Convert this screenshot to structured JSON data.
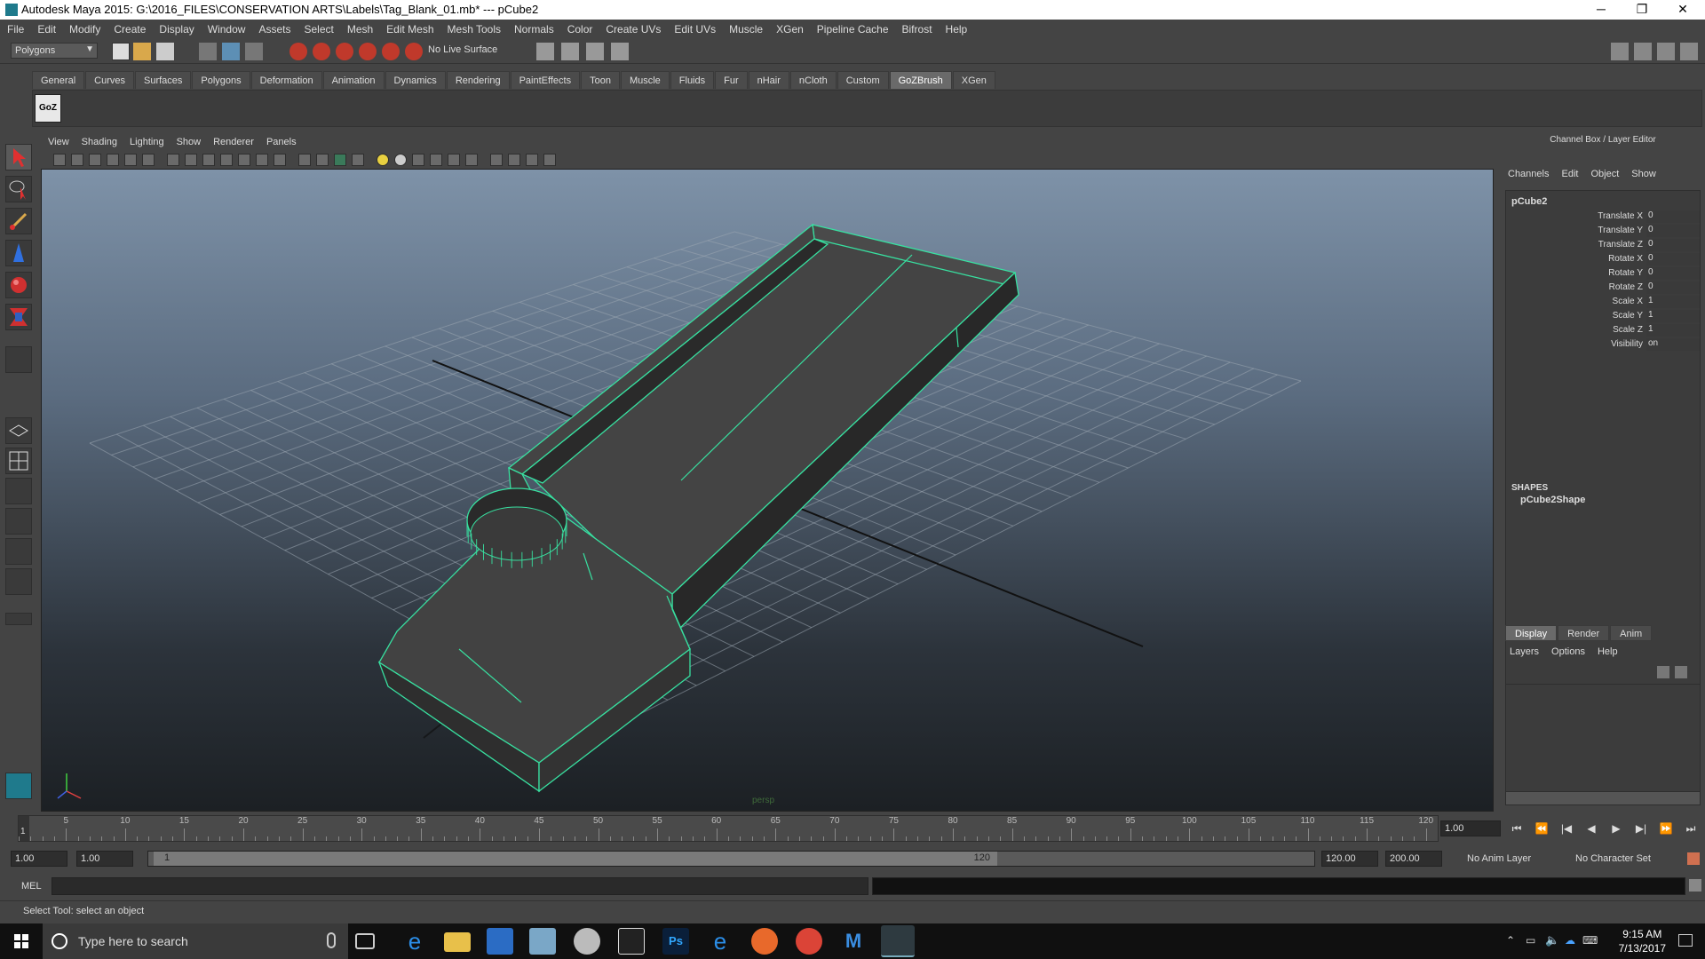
{
  "window": {
    "title": "Autodesk Maya 2015: G:\\2016_FILES\\CONSERVATION ARTS\\Labels\\Tag_Blank_01.mb*   ---   pCube2",
    "minimize": "─",
    "maximize": "❐",
    "close": "✕"
  },
  "menubar": [
    "File",
    "Edit",
    "Modify",
    "Create",
    "Display",
    "Window",
    "Assets",
    "Select",
    "Mesh",
    "Edit Mesh",
    "Mesh Tools",
    "Normals",
    "Color",
    "Create UVs",
    "Edit UVs",
    "Muscle",
    "XGen",
    "Pipeline Cache",
    "Bifrost",
    "Help"
  ],
  "statusline": {
    "menu_set": "Polygons",
    "live_surface": "No Live Surface"
  },
  "shelf": {
    "tabs": [
      "General",
      "Curves",
      "Surfaces",
      "Polygons",
      "Deformation",
      "Animation",
      "Dynamics",
      "Rendering",
      "PaintEffects",
      "Toon",
      "Muscle",
      "Fluids",
      "Fur",
      "nHair",
      "nCloth",
      "Custom",
      "GoZBrush",
      "XGen"
    ],
    "active_tab": "GoZBrush",
    "goz_label": "GoZ"
  },
  "viewport": {
    "menus": [
      "View",
      "Shading",
      "Lighting",
      "Show",
      "Renderer",
      "Panels"
    ],
    "camera_label": "persp"
  },
  "channel_box": {
    "header": "Channel Box / Layer Editor",
    "menus": [
      "Channels",
      "Edit",
      "Object",
      "Show"
    ],
    "object_name": "pCube2",
    "attributes": [
      {
        "label": "Translate X",
        "value": "0"
      },
      {
        "label": "Translate Y",
        "value": "0"
      },
      {
        "label": "Translate Z",
        "value": "0"
      },
      {
        "label": "Rotate X",
        "value": "0"
      },
      {
        "label": "Rotate Y",
        "value": "0"
      },
      {
        "label": "Rotate Z",
        "value": "0"
      },
      {
        "label": "Scale X",
        "value": "1"
      },
      {
        "label": "Scale Y",
        "value": "1"
      },
      {
        "label": "Scale Z",
        "value": "1"
      },
      {
        "label": "Visibility",
        "value": "on"
      }
    ],
    "shapes_label": "SHAPES",
    "shape_name": "pCube2Shape"
  },
  "layer_editor": {
    "tabs": [
      "Display",
      "Render",
      "Anim"
    ],
    "active_tab": "Display",
    "menus": [
      "Layers",
      "Options",
      "Help"
    ]
  },
  "timeline": {
    "tick_labels": [
      "5",
      "10",
      "15",
      "20",
      "25",
      "30",
      "35",
      "40",
      "45",
      "50",
      "55",
      "60",
      "65",
      "70",
      "75",
      "80",
      "85",
      "90",
      "95",
      "100",
      "105",
      "110",
      "115",
      "120"
    ],
    "current_marker": "1",
    "current_frame": "1.00",
    "playback": [
      "⏮",
      "⏪",
      "|◀",
      "◀",
      "▶",
      "▶|",
      "⏩",
      "⏭"
    ]
  },
  "range": {
    "start": "1.00",
    "playback_start": "1.00",
    "range_low": "1",
    "range_high": "120",
    "playback_end": "120.00",
    "end": "200.00",
    "anim_layer": "No Anim Layer",
    "character_set": "No Character Set"
  },
  "command": {
    "mel_label": "MEL"
  },
  "help_line": "Select Tool: select an object",
  "taskbar": {
    "search_placeholder": "Type here to search",
    "time": "9:15 AM",
    "date": "7/13/2017"
  },
  "colors": {
    "wireframe_highlight": "#38e0a0",
    "mesh_face": "#3f3f3f",
    "grid": "#9aa6b0"
  }
}
